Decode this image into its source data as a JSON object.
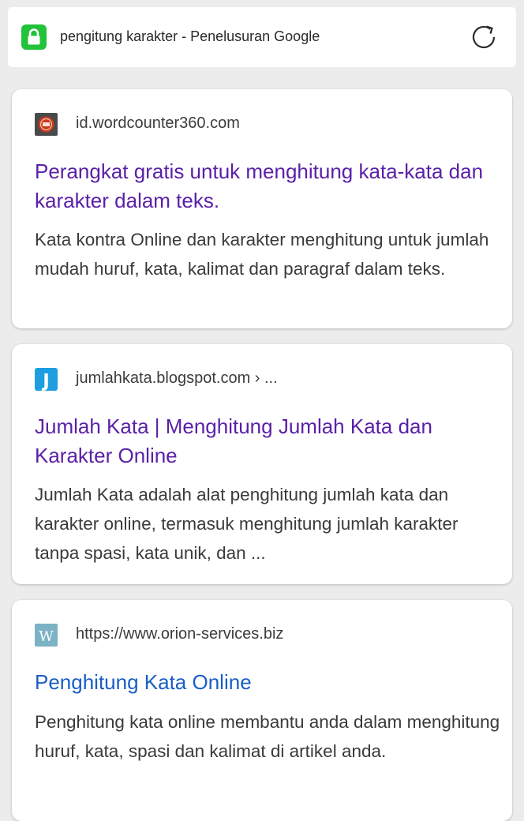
{
  "topbar": {
    "address": "pengitung karakter - Penelusuran Google",
    "lock_icon": "lock-icon",
    "reload_icon": "reload-icon",
    "lock_color": "#22c33a"
  },
  "results": [
    {
      "site": "id.wordcounter360.com",
      "title": "Perangkat gratis untuk menghitung kata-kata dan karakter dalam teks.",
      "snippet": "Kata kontra Online dan karakter menghitung untuk jumlah mudah huruf, kata, kalimat dan paragraf dalam teks.",
      "title_color": "#5a20a8"
    },
    {
      "site": "jumlahkata.blogspot.com › ...",
      "title": "Jumlah Kata | Menghitung Jumlah Kata dan Karakter Online",
      "snippet": "Jumlah Kata adalah alat penghitung jumlah kata dan karakter online, termasuk menghitung jumlah karakter tanpa spasi, kata unik, dan ...",
      "favicon_letter": "J",
      "title_color": "#5a20a8"
    },
    {
      "site": "https://www.orion-services.biz",
      "title": "Penghitung Kata Online",
      "snippet": "Penghitung kata online membantu anda dalam menghitung huruf, kata, spasi dan kalimat di artikel anda.",
      "favicon_letter": "W",
      "title_color": "#1a5ec4"
    }
  ]
}
